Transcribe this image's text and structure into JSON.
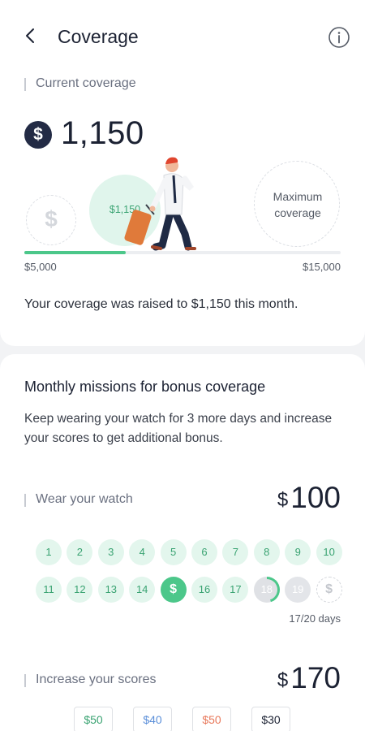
{
  "header": {
    "title": "Coverage",
    "back_icon": "chevron-left-icon",
    "info_icon": "info-icon"
  },
  "current": {
    "label": "Current coverage",
    "amount": "1,150",
    "currency_symbol": "$",
    "circle_min_symbol": "$",
    "circle_current_label": "$1,150",
    "circle_max_label": "Maximum coverage",
    "min_tick": "$5,000",
    "max_tick": "$15,000",
    "progress_fraction": 0.32,
    "message": "Your coverage was raised to $1,150 this month."
  },
  "missions": {
    "title": "Monthly missions for bonus coverage",
    "description": "Keep wearing your watch for 3 more days and increase your scores to get additional bonus."
  },
  "wear": {
    "label": "Wear your watch",
    "currency_symbol": "$",
    "amount": "100",
    "days": [
      {
        "label": "1",
        "state": "done"
      },
      {
        "label": "2",
        "state": "done"
      },
      {
        "label": "3",
        "state": "done"
      },
      {
        "label": "4",
        "state": "done"
      },
      {
        "label": "5",
        "state": "done"
      },
      {
        "label": "6",
        "state": "done"
      },
      {
        "label": "7",
        "state": "done"
      },
      {
        "label": "8",
        "state": "done"
      },
      {
        "label": "9",
        "state": "done"
      },
      {
        "label": "10",
        "state": "done"
      },
      {
        "label": "11",
        "state": "done"
      },
      {
        "label": "12",
        "state": "done"
      },
      {
        "label": "13",
        "state": "done"
      },
      {
        "label": "14",
        "state": "done"
      },
      {
        "label": "$",
        "state": "bonus"
      },
      {
        "label": "16",
        "state": "done"
      },
      {
        "label": "17",
        "state": "done"
      },
      {
        "label": "18",
        "state": "progress"
      },
      {
        "label": "19",
        "state": "future"
      },
      {
        "label": "$",
        "state": "goal"
      }
    ],
    "days_count": "17/20 days"
  },
  "scores": {
    "label": "Increase your scores",
    "currency_symbol": "$",
    "amount": "170",
    "chips": [
      {
        "label": "$50",
        "color": "#3aa372"
      },
      {
        "label": "$40",
        "color": "#5b8fd9"
      },
      {
        "label": "$50",
        "color": "#e8785a"
      },
      {
        "label": "$30",
        "color": "#1c2233"
      }
    ]
  },
  "colors": {
    "accent": "#4cc78a",
    "accent_light": "#e0f5ec",
    "dark": "#232b45"
  }
}
